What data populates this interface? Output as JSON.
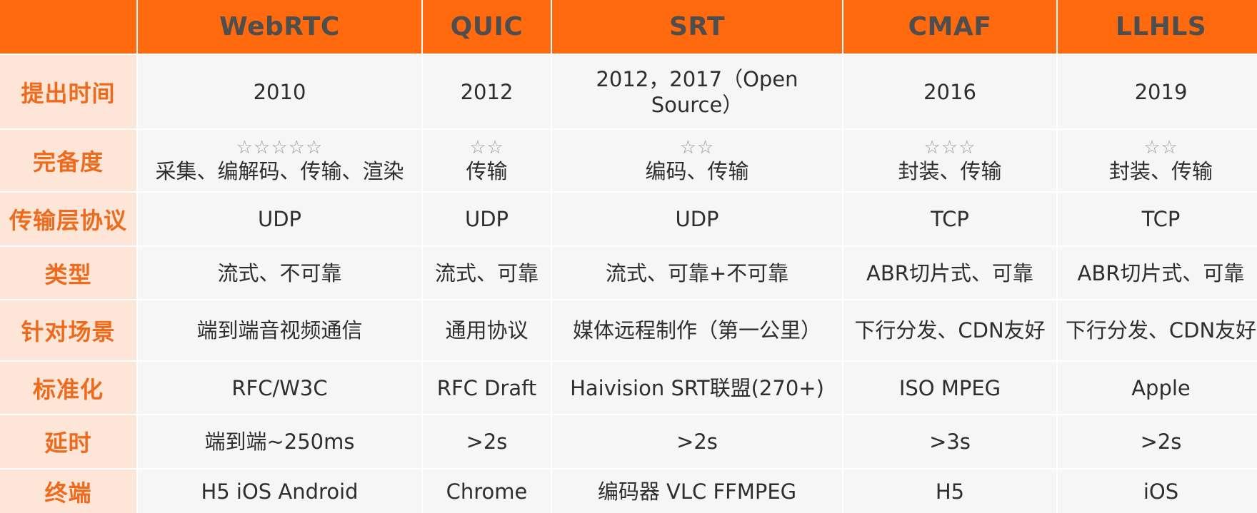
{
  "columns": [
    "WebRTC",
    "QUIC",
    "SRT",
    "CMAF",
    "LLHLS"
  ],
  "rows": [
    {
      "label": "提出时间",
      "cells": [
        "2010",
        "2012",
        "2012，2017（Open Source）",
        "2016",
        "2019"
      ]
    },
    {
      "label": "完备度",
      "stars": [
        "☆☆☆☆☆",
        "☆☆",
        "☆☆",
        "☆☆☆",
        "☆☆"
      ],
      "cells": [
        "采集、编解码、传输、渲染",
        "传输",
        "编码、传输",
        "封装、传输",
        "封装、传输"
      ]
    },
    {
      "label": "传输层协议",
      "cells": [
        "UDP",
        "UDP",
        "UDP",
        "TCP",
        "TCP"
      ]
    },
    {
      "label": "类型",
      "cells": [
        "流式、不可靠",
        "流式、可靠",
        "流式、可靠+不可靠",
        "ABR切片式、可靠",
        "ABR切片式、可靠"
      ]
    },
    {
      "label": "针对场景",
      "cells": [
        "端到端音视频通信",
        "通用协议",
        "媒体远程制作（第一公里）",
        "下行分发、CDN友好",
        "下行分发、CDN友好"
      ]
    },
    {
      "label": "标准化",
      "cells": [
        "RFC/W3C",
        "RFC Draft",
        "Haivision SRT联盟(270+)",
        "ISO MPEG",
        "Apple"
      ]
    },
    {
      "label": "延时",
      "cells": [
        "端到端~250ms",
        ">2s",
        ">2s",
        ">3s",
        ">2s"
      ]
    },
    {
      "label": "终端",
      "cells": [
        "H5 iOS Android",
        "Chrome",
        "编码器 VLC FFMPEG",
        "H5",
        "iOS"
      ]
    }
  ],
  "colors": {
    "header_bg": "#ff6a0e",
    "header_text": "#4e4e4e",
    "label_bg": "#fde6d8",
    "label_text": "#ee6a1c",
    "cell_bg": "#f6f6f6",
    "cell_text": "#2e2e2e",
    "star_color": "#9a9a9a"
  }
}
